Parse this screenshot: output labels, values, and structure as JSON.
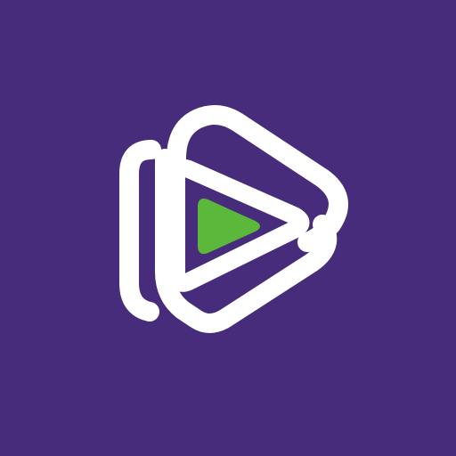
{
  "app_icon": {
    "icon_name": "play-button-logo-icon",
    "colors": {
      "background": "#462c7a",
      "outline": "#ffffff",
      "play_triangle": "#5cb83a"
    }
  }
}
